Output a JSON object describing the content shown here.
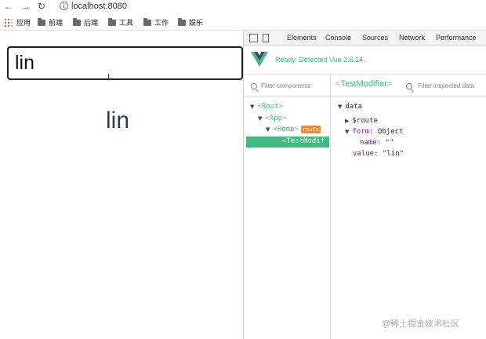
{
  "browser": {
    "url": "localhost:8080",
    "bookmarks": [
      {
        "label": "应用",
        "icon": "apps-grid-icon"
      },
      {
        "label": "前端",
        "icon": "folder-icon"
      },
      {
        "label": "后端",
        "icon": "folder-icon"
      },
      {
        "label": "工具",
        "icon": "folder-icon"
      },
      {
        "label": "工作",
        "icon": "folder-icon"
      },
      {
        "label": "娱乐",
        "icon": "folder-icon"
      }
    ]
  },
  "page": {
    "input_value": "lin",
    "echo_text": "lin"
  },
  "devtools": {
    "tabs": [
      "Elements",
      "Console",
      "Sources",
      "Network",
      "Performance"
    ],
    "vue_status": "Ready. Detected Vue 2.6.14.",
    "filter_components_placeholder": "Filter components",
    "selected_component": "TestModifier",
    "filter_data_placeholder": "Filter inspected data",
    "tree": {
      "root": "Root",
      "app": "App",
      "home": "Home",
      "home_badge": "route",
      "selected": "TestModif"
    },
    "data": {
      "section": "data",
      "route_key": "$route",
      "form_key": "form",
      "form_type": "Object",
      "name_key": "name",
      "name_value": "\"\"",
      "value_key": "value",
      "value_value": "\"lin\""
    },
    "accent_color": "#42b983"
  },
  "watermark": "@稀土掘金技术社区"
}
